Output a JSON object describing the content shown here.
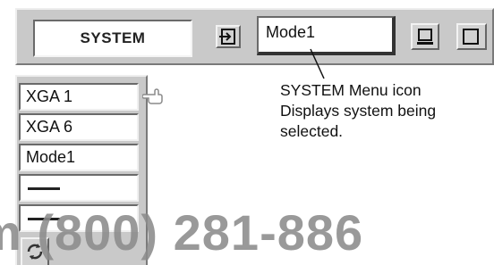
{
  "header": {
    "system_label": "SYSTEM",
    "mode_value": "Mode1"
  },
  "list": {
    "items": [
      {
        "label": "XGA 1",
        "type": "text"
      },
      {
        "label": "XGA 6",
        "type": "text"
      },
      {
        "label": "Mode1",
        "type": "text"
      },
      {
        "label": "",
        "type": "blank"
      },
      {
        "label": "",
        "type": "blank"
      }
    ],
    "pointer_icon": "hand-pointer-icon",
    "refresh_icon": "refresh-icon"
  },
  "callout": {
    "line1": "SYSTEM Menu icon",
    "line2": "Displays system being",
    "line3": "selected."
  },
  "watermark": {
    "text": "m (800) 281-886"
  },
  "icons": {
    "enter": "enter-icon",
    "monitor": "monitor-icon",
    "window": "window-icon"
  },
  "colors": {
    "panel": "#c9c9c9",
    "watermark": "#8c8c8c"
  }
}
